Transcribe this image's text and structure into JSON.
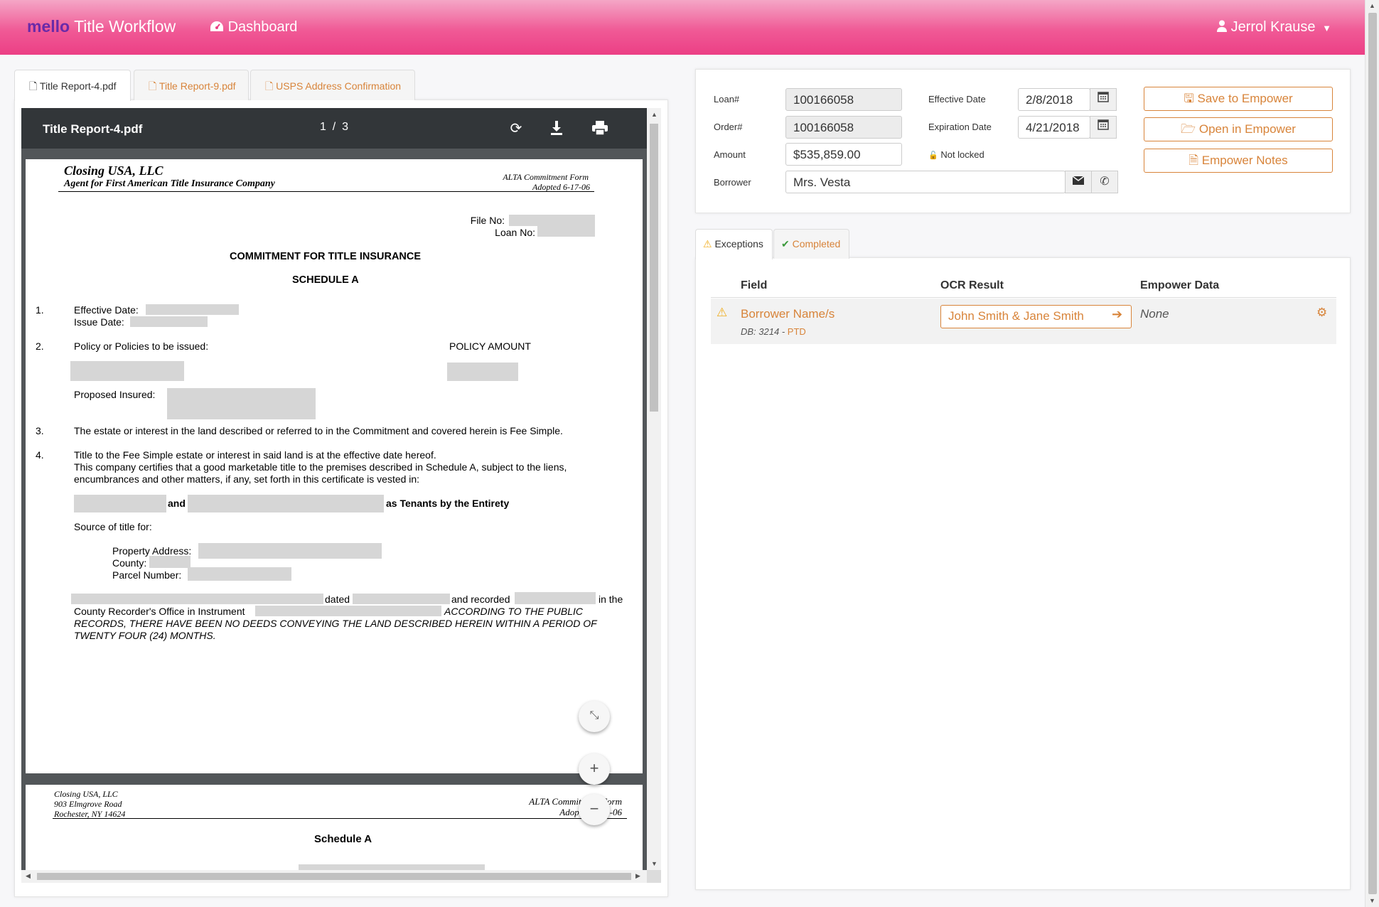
{
  "nav": {
    "brand_prefix": "mello",
    "brand_name": "Title Workflow",
    "dashboard_label": "Dashboard",
    "user_name": "Jerrol Krause"
  },
  "left_tabs": [
    {
      "label": "Title Report-4.pdf",
      "active": true
    },
    {
      "label": "Title Report-9.pdf",
      "active": false
    },
    {
      "label": "USPS Address Confirmation",
      "active": false
    }
  ],
  "pdf": {
    "file_name": "Title Report-4.pdf",
    "page_current": "1",
    "page_separator": "/",
    "page_total": "3",
    "page1": {
      "company": "Closing USA, LLC",
      "agent": "Agent for First American Title Insurance Company",
      "form_name": "ALTA Commitment Form",
      "form_adopted": "Adopted 6-17-06",
      "file_no_label": "File No:",
      "loan_no_label": "Loan No:",
      "heading": "COMMITMENT FOR TITLE INSURANCE",
      "subheading": "SCHEDULE A",
      "item1_num": "1.",
      "effective_date_label": "Effective Date:",
      "issue_date_label": "Issue Date:",
      "item2_num": "2.",
      "policy_label": "Policy or Policies to be issued:",
      "policy_amount_label": "POLICY AMOUNT",
      "proposed_insured_label": "Proposed Insured:",
      "item3_num": "3.",
      "item3_text": "The estate or interest in the land described or referred to in the Commitment and covered herein is Fee Simple.",
      "item4_num": "4.",
      "item4_line1": "Title to the Fee Simple estate or interest in said land is at the effective date hereof.",
      "item4_line2": "This company certifies that a good marketable title to the premises described in Schedule A, subject to the liens,",
      "item4_line3": "encumbrances and other matters, if any, set forth in this certificate is vested in:",
      "and_word": "and",
      "tenants_text": "as Tenants by the Entirety",
      "source_label": "Source of title for:",
      "property_address_label": "Property Address:",
      "county_label": "County:",
      "parcel_label": "Parcel Number:",
      "dated_word": "dated",
      "recorded_text": "and recorded",
      "in_the_text": "in the",
      "county_recorder_text": "County Recorder's Office in Instrument",
      "public_records_1": "ACCORDING TO THE PUBLIC",
      "public_records_2": "RECORDS, THERE HAVE BEEN NO DEEDS CONVEYING THE LAND DESCRIBED HEREIN WITHIN A PERIOD OF",
      "public_records_3": "TWENTY FOUR (24) MONTHS."
    },
    "page2": {
      "company": "Closing USA, LLC",
      "address1": "903 Elmgrove Road",
      "address2": "Rochester, NY 14624",
      "form_name": "ALTA Commitment Form",
      "form_adopted": "Adopted 6-17-06",
      "heading": "Schedule A"
    }
  },
  "form": {
    "loan_label": "Loan#",
    "loan_value": "100166058",
    "order_label": "Order#",
    "order_value": "100166058",
    "amount_label": "Amount",
    "amount_value": "$535,859.00",
    "borrower_label": "Borrower",
    "borrower_value": "Mrs. Vesta",
    "effective_date_label": "Effective Date",
    "effective_date_value": "2/8/2018",
    "expiration_date_label": "Expiration Date",
    "expiration_date_value": "4/21/2018",
    "lock_status": "Not locked",
    "save_button": "Save to Empower",
    "open_button": "Open in Empower",
    "notes_button": "Empower Notes"
  },
  "right_tabs": [
    {
      "label": "Exceptions",
      "active": true
    },
    {
      "label": "Completed",
      "active": false
    }
  ],
  "exceptions_table": {
    "headers": [
      "Field",
      "OCR Result",
      "Empower Data"
    ],
    "rows": [
      {
        "field": "Borrower Name/s",
        "db_prefix": "DB: 3214 -",
        "db_link": "PTD",
        "ocr_result": "John Smith & Jane Smith",
        "empower_data": "None"
      }
    ]
  },
  "colors": {
    "accent": "#d8843a",
    "nav_pink": "#ec3f85",
    "brand_purple": "#6a2aa8",
    "warning": "#f0ad1e",
    "success": "#3c9a3c"
  }
}
